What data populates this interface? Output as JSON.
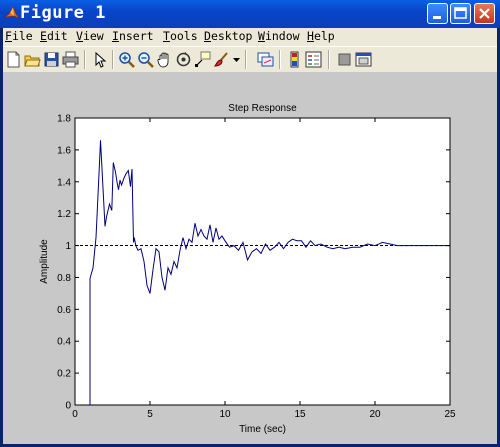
{
  "window": {
    "title": "Figure 1",
    "controls": [
      "minimize",
      "maximize",
      "close"
    ]
  },
  "menu": [
    "File",
    "Edit",
    "View",
    "Insert",
    "Tools",
    "Desktop",
    "Window",
    "Help"
  ],
  "menu_mnemonics": [
    "F",
    "E",
    "V",
    "I",
    "T",
    "D",
    "W",
    "H"
  ],
  "toolbar": [
    "new-figure-icon",
    "open-file-icon",
    "save-icon",
    "print-icon",
    "edit-plot-icon",
    "zoom-in-icon",
    "zoom-out-icon",
    "pan-icon",
    "rotate-3d-icon",
    "data-cursor-icon",
    "brush-icon",
    "brush-dropdown-icon",
    "link-plot-icon",
    "insert-colorbar-icon",
    "insert-legend-icon",
    "hide-plot-tools-icon",
    "show-plot-tools-icon"
  ],
  "colors": {
    "titlebar": "#0a4fd6",
    "figure_bg": "#c8c8c8",
    "axes_bg": "#ffffff",
    "response_line": "#00007f",
    "reference_line": "#000000"
  },
  "chart_data": {
    "type": "line",
    "title": "Step Response",
    "xlabel": "Time (sec)",
    "ylabel": "Amplitude",
    "xlim": [
      0,
      25
    ],
    "ylim": [
      0,
      1.8
    ],
    "xticks": [
      0,
      5,
      10,
      15,
      20,
      25
    ],
    "yticks": [
      0,
      0.2,
      0.4,
      0.6,
      0.8,
      1,
      1.2,
      1.4,
      1.6,
      1.8
    ],
    "grid": false,
    "reference": {
      "style": "dashed",
      "y": 1,
      "x_range": [
        0,
        25
      ]
    },
    "series": [
      {
        "style": "solid",
        "x": [
          0,
          1.0,
          1.0,
          1.02,
          1.2,
          1.4,
          1.6,
          1.7,
          1.9,
          2.0,
          2.1,
          2.3,
          2.45,
          2.55,
          2.7,
          2.8,
          2.9,
          3.0,
          3.1,
          3.25,
          3.4,
          3.55,
          3.7,
          3.8,
          3.9,
          3.95,
          4.05,
          4.2,
          4.4,
          4.6,
          4.8,
          5.0,
          5.2,
          5.4,
          5.6,
          5.8,
          6.0,
          6.2,
          6.4,
          6.6,
          6.8,
          7.0,
          7.2,
          7.4,
          7.6,
          7.8,
          8.0,
          8.2,
          8.4,
          8.6,
          8.8,
          9.0,
          9.2,
          9.4,
          9.6,
          9.8,
          10.0,
          10.3,
          10.6,
          10.9,
          11.2,
          11.5,
          11.8,
          12.1,
          12.4,
          12.7,
          13.0,
          13.3,
          13.6,
          13.9,
          14.2,
          14.5,
          14.8,
          15.1,
          15.4,
          15.7,
          16.0,
          16.4,
          16.8,
          17.2,
          17.6,
          18.0,
          18.5,
          19.0,
          19.5,
          20.0,
          20.5,
          21.0,
          21.5,
          22.0,
          22.5,
          23.0,
          24.0,
          25.0
        ],
        "values": [
          0,
          0,
          0.79,
          0.8,
          0.86,
          1.05,
          1.45,
          1.66,
          1.3,
          1.12,
          1.18,
          1.26,
          1.22,
          1.52,
          1.46,
          1.4,
          1.35,
          1.41,
          1.38,
          1.42,
          1.45,
          1.47,
          1.37,
          1.48,
          1.02,
          1.05,
          1.0,
          0.97,
          0.98,
          0.9,
          0.75,
          0.7,
          0.85,
          0.98,
          0.96,
          0.8,
          0.72,
          0.86,
          0.82,
          0.9,
          0.86,
          0.97,
          1.05,
          0.98,
          1.04,
          1.02,
          1.14,
          1.06,
          1.1,
          1.06,
          1.04,
          1.13,
          1.02,
          1.11,
          1.04,
          1.06,
          1.03,
          0.99,
          1.0,
          0.97,
          1.02,
          0.91,
          0.96,
          0.98,
          0.95,
          1.01,
          0.97,
          0.99,
          1.02,
          0.98,
          1.02,
          1.04,
          1.03,
          1.03,
          0.99,
          1.03,
          1.0,
          1.01,
          0.99,
          0.98,
          0.99,
          0.98,
          0.99,
          0.99,
          1.01,
          1.0,
          1.02,
          1.01,
          1.0,
          1.0,
          1.0,
          1.0,
          1.0,
          1.0
        ]
      }
    ]
  }
}
